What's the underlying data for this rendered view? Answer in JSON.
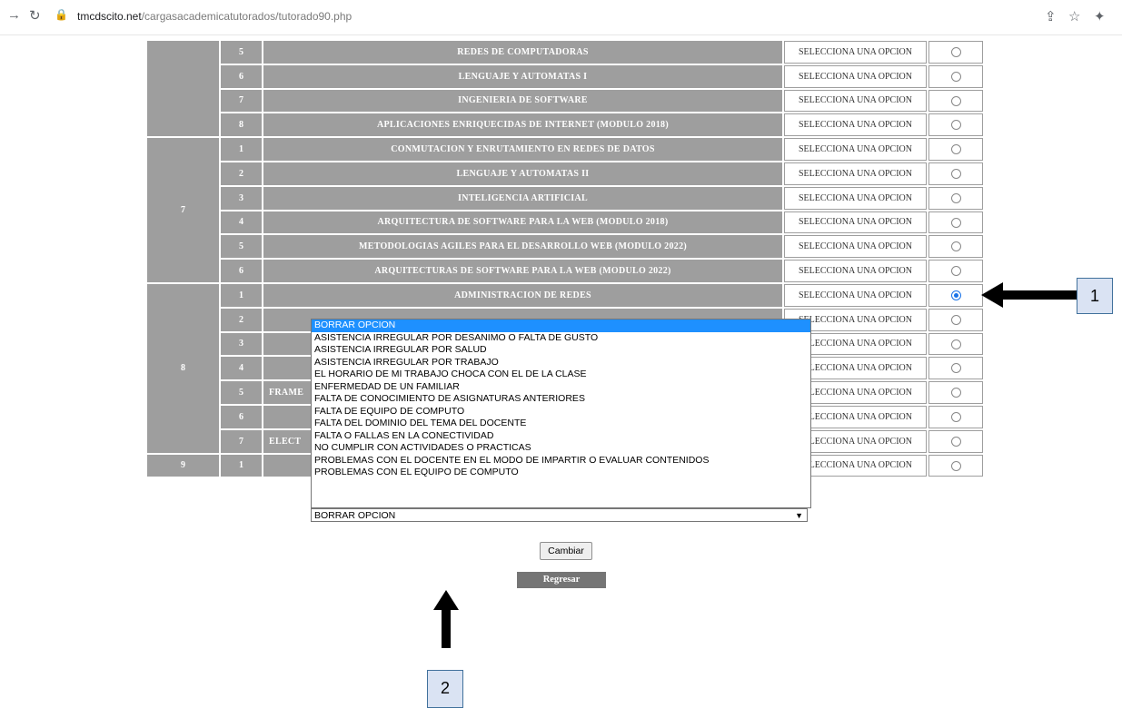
{
  "browser": {
    "host": "tmcdscito.net",
    "path": "/cargasacademicatutorados/tutorado90.php"
  },
  "rows": [
    {
      "sem": "",
      "num": "5",
      "subject": "REDES DE COMPUTADORAS",
      "option": "SELECCIONA UNA OPCION",
      "checked": false
    },
    {
      "sem": "",
      "num": "6",
      "subject": "LENGUAJE Y AUTOMATAS I",
      "option": "SELECCIONA UNA OPCION",
      "checked": false
    },
    {
      "sem": "",
      "num": "7",
      "subject": "INGENIERIA DE SOFTWARE",
      "option": "SELECCIONA UNA OPCION",
      "checked": false
    },
    {
      "sem": "",
      "num": "8",
      "subject": "APLICACIONES ENRIQUECIDAS DE INTERNET (MODULO 2018)",
      "option": "SELECCIONA UNA OPCION",
      "checked": false
    },
    {
      "sem": "7",
      "num": "1",
      "subject": "CONMUTACION Y ENRUTAMIENTO EN REDES DE DATOS",
      "option": "SELECCIONA UNA OPCION",
      "checked": false
    },
    {
      "sem": "",
      "num": "2",
      "subject": "LENGUAJE Y AUTOMATAS II",
      "option": "SELECCIONA UNA OPCION",
      "checked": false
    },
    {
      "sem": "",
      "num": "3",
      "subject": "INTELIGENCIA ARTIFICIAL",
      "option": "SELECCIONA UNA OPCION",
      "checked": false
    },
    {
      "sem": "",
      "num": "4",
      "subject": "ARQUITECTURA DE SOFTWARE PARA LA WEB (MODULO 2018)",
      "option": "SELECCIONA UNA OPCION",
      "checked": false
    },
    {
      "sem": "",
      "num": "5",
      "subject": "METODOLOGIAS AGILES PARA EL DESARROLLO WEB (MODULO 2022)",
      "option": "SELECCIONA UNA OPCION",
      "checked": false
    },
    {
      "sem": "",
      "num": "6",
      "subject": "ARQUITECTURAS DE SOFTWARE PARA LA WEB (MODULO 2022)",
      "option": "SELECCIONA UNA OPCION",
      "checked": false
    },
    {
      "sem": "8",
      "num": "1",
      "subject": "ADMINISTRACION DE REDES",
      "option": "SELECCIONA UNA OPCION",
      "checked": true
    },
    {
      "sem": "",
      "num": "2",
      "subject": "",
      "option": "SELECCIONA UNA OPCION",
      "checked": false
    },
    {
      "sem": "",
      "num": "3",
      "subject": "",
      "option": "SELECCIONA UNA OPCION",
      "checked": false
    },
    {
      "sem": "",
      "num": "4",
      "subject": "",
      "option": "SELECCIONA UNA OPCION",
      "checked": false
    },
    {
      "sem": "",
      "num": "5",
      "subject": "FRAME",
      "option": "SELECCIONA UNA OPCION",
      "checked": false
    },
    {
      "sem": "",
      "num": "6",
      "subject": "",
      "option": "SELECCIONA UNA OPCION",
      "checked": false
    },
    {
      "sem": "",
      "num": "7",
      "subject": "ELECT",
      "option": "SELECCIONA UNA OPCION",
      "checked": false
    },
    {
      "sem": "9",
      "num": "1",
      "subject": "",
      "option": "SELECCIONA UNA OPCION",
      "checked": false
    }
  ],
  "dropdown": {
    "options": [
      "BORRAR OPCION",
      "ASISTENCIA IRREGULAR POR DESANIMO O FALTA DE GUSTO",
      "ASISTENCIA IRREGULAR POR SALUD",
      "ASISTENCIA IRREGULAR POR TRABAJO",
      "EL HORARIO DE MI TRABAJO CHOCA CON EL DE LA CLASE",
      "ENFERMEDAD DE UN FAMILIAR",
      "FALTA DE CONOCIMIENTO DE ASIGNATURAS ANTERIORES",
      "FALTA DE EQUIPO DE COMPUTO",
      "FALTA DEL DOMINIO DEL TEMA DEL DOCENTE",
      "FALTA O FALLAS EN LA CONECTIVIDAD",
      "NO CUMPLIR CON ACTIVIDADES O PRACTICAS",
      "PROBLEMAS CON EL DOCENTE EN EL MODO DE IMPARTIR O EVALUAR CONTENIDOS",
      "PROBLEMAS CON EL EQUIPO DE COMPUTO"
    ],
    "highlighted_index": 0,
    "selected_value": "BORRAR OPCION"
  },
  "buttons": {
    "cambiar": "Cambiar",
    "regresar": "Regresar"
  },
  "callouts": {
    "one": "1",
    "two": "2"
  },
  "colors": {
    "cell_gray": "#9e9e9e",
    "highlight_blue": "#1e90ff",
    "callout_fill": "#dae3f3"
  }
}
